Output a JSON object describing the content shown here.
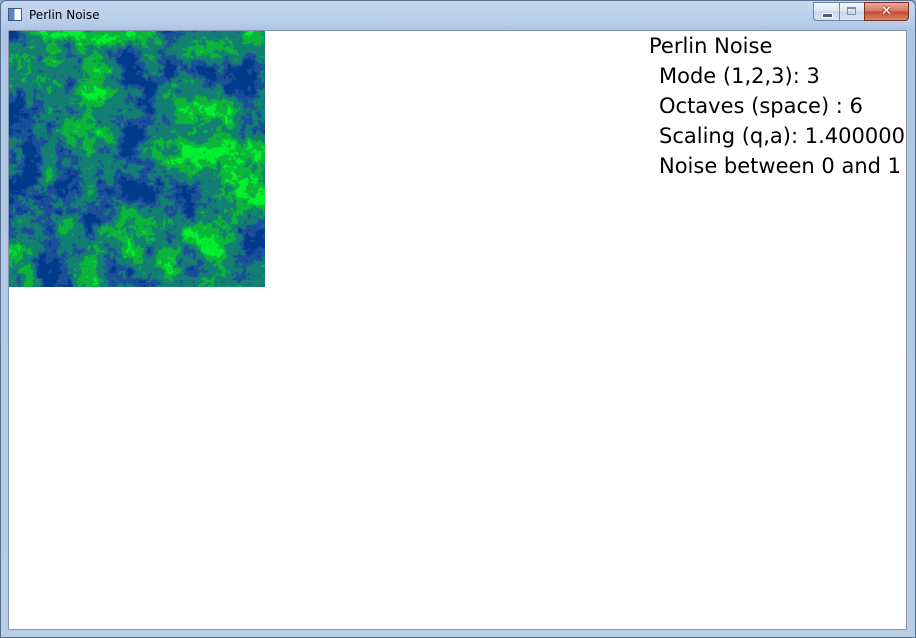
{
  "window": {
    "title": "Perlin Noise",
    "icon": "app-window-icon",
    "buttons": {
      "minimize": "minimize-icon",
      "maximize": "maximize-icon",
      "close": "close-icon",
      "close_glyph": "✕"
    }
  },
  "info": {
    "heading": "Perlin Noise",
    "mode": "Mode (1,2,3): 3",
    "octaves": "Octaves (space) : 6",
    "scaling": "Scaling (q,a): 1.400000",
    "range": "Noise between 0 and 1"
  },
  "noise_palette": [
    "#003a8a",
    "#1c4f9a",
    "#137e72",
    "#0cb43a",
    "#00f030"
  ]
}
